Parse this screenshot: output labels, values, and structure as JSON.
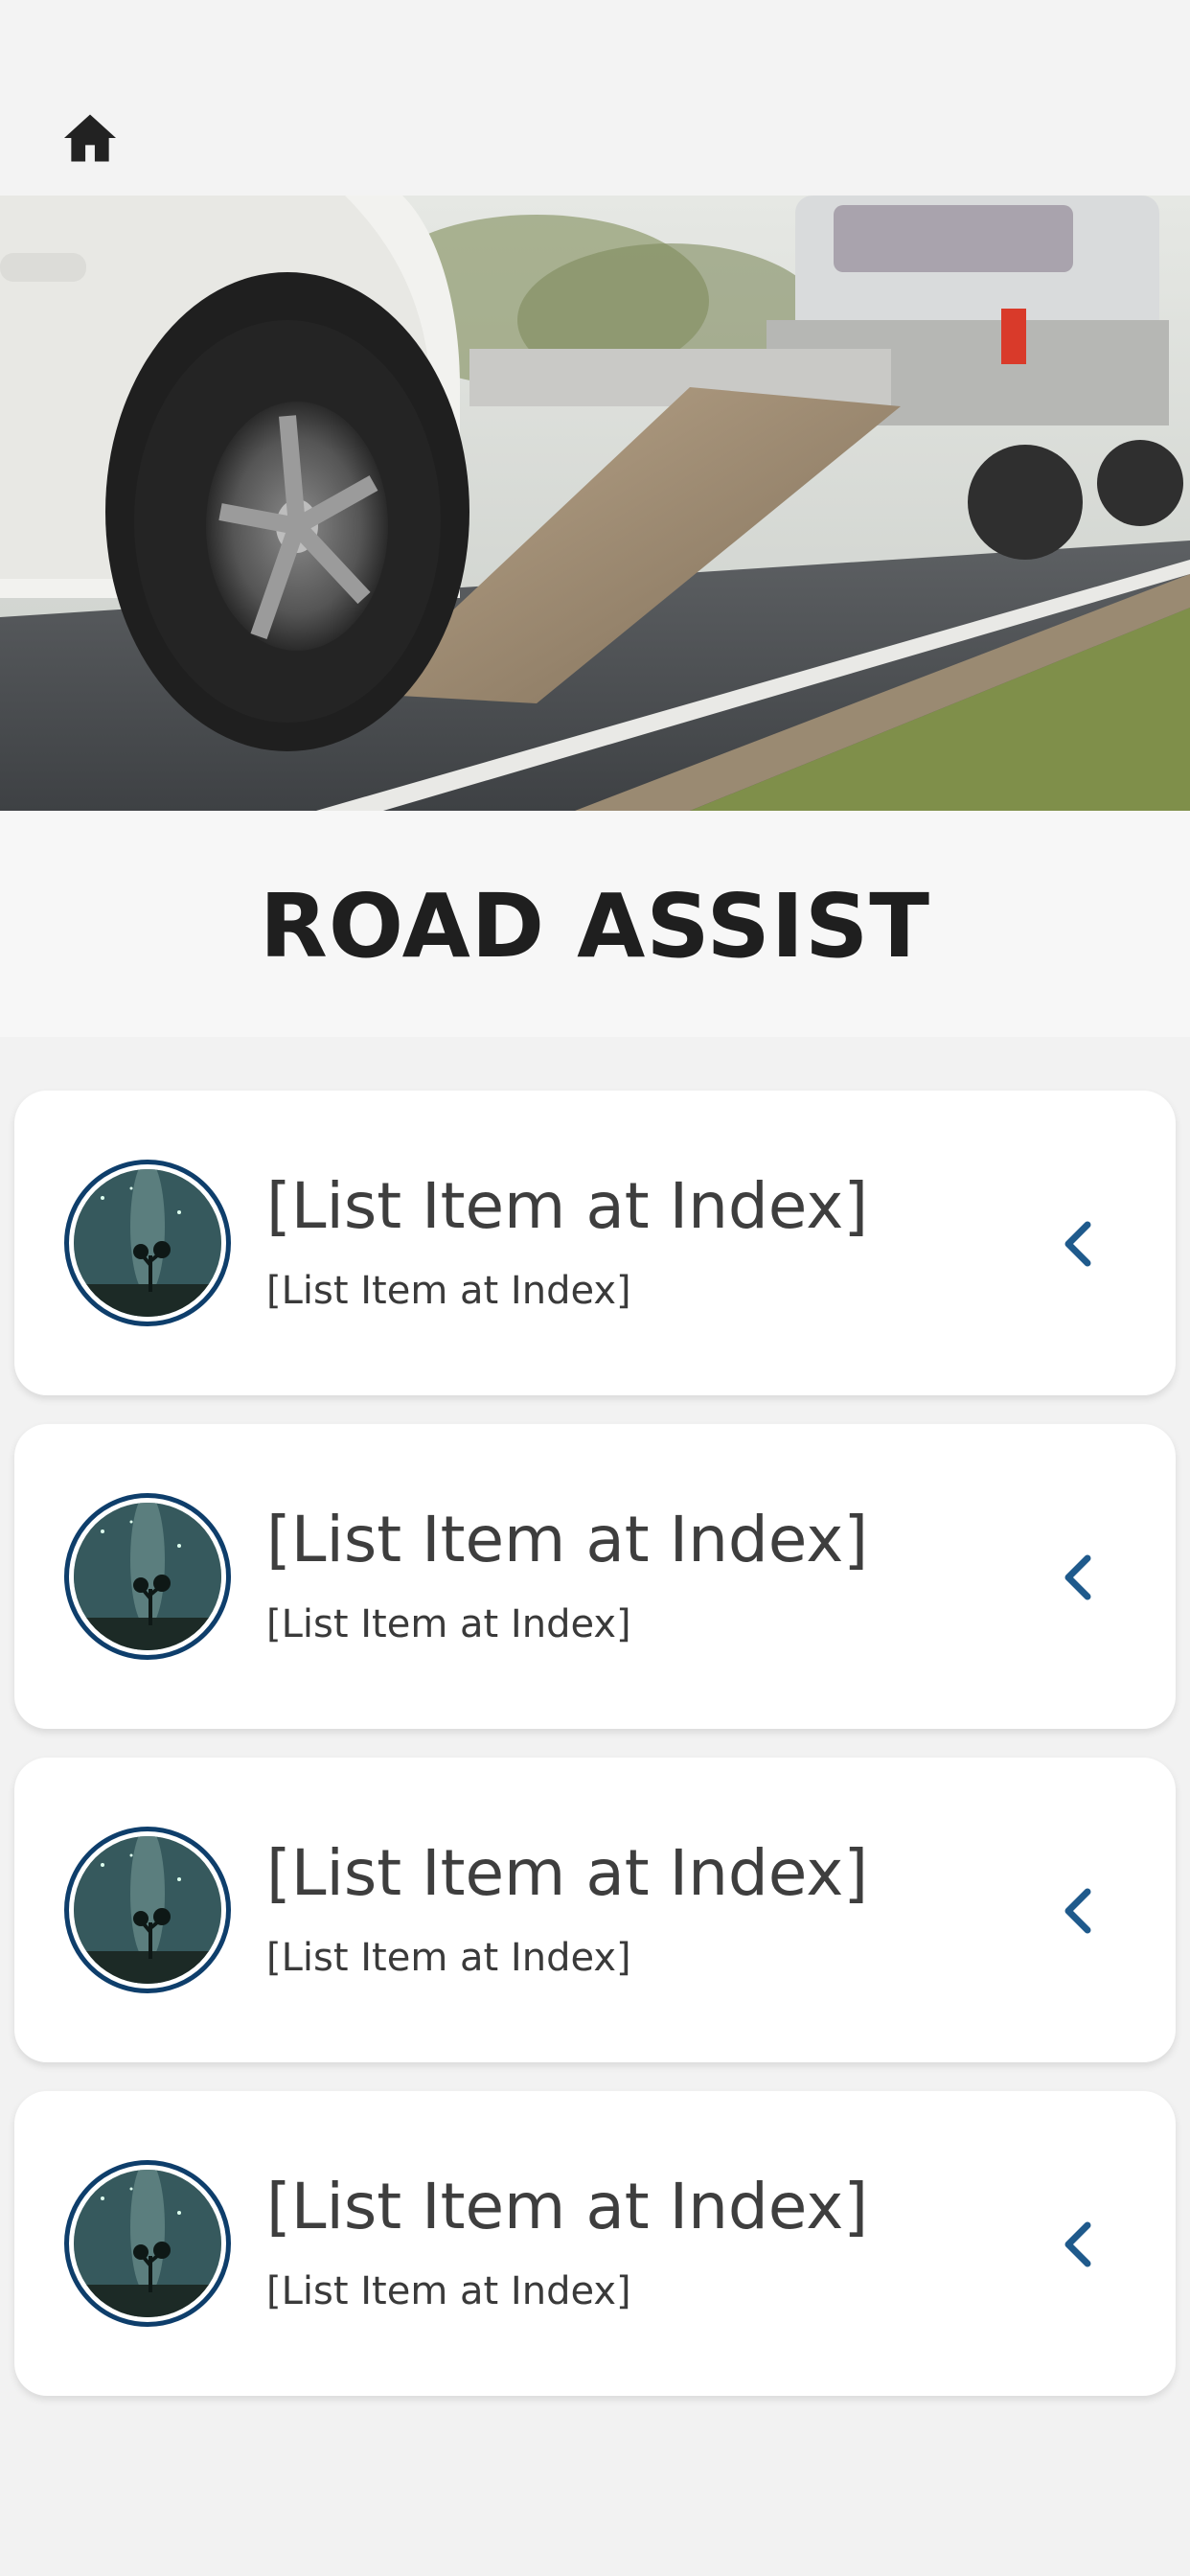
{
  "header": {
    "home_icon": "home-icon"
  },
  "hero": {
    "image": "tow-truck-loading-car-photo"
  },
  "title_band": {
    "title": "ROAD ASSIST"
  },
  "colors": {
    "accent": "#0e3e6b",
    "chevron": "#1f5a8c",
    "card_bg": "#ffffff",
    "page_bg": "#f2f2f2"
  },
  "list": {
    "items": [
      {
        "title": "[List Item at Index]",
        "subtitle": "[List Item at Index]",
        "avatar": "night-sky-tree-avatar",
        "chevron": "chevron-left-icon"
      },
      {
        "title": "[List Item at Index]",
        "subtitle": "[List Item at Index]",
        "avatar": "night-sky-tree-avatar",
        "chevron": "chevron-left-icon"
      },
      {
        "title": "[List Item at Index]",
        "subtitle": "[List Item at Index]",
        "avatar": "night-sky-tree-avatar",
        "chevron": "chevron-left-icon"
      },
      {
        "title": "[List Item at Index]",
        "subtitle": "[List Item at Index]",
        "avatar": "night-sky-tree-avatar",
        "chevron": "chevron-left-icon"
      }
    ]
  }
}
